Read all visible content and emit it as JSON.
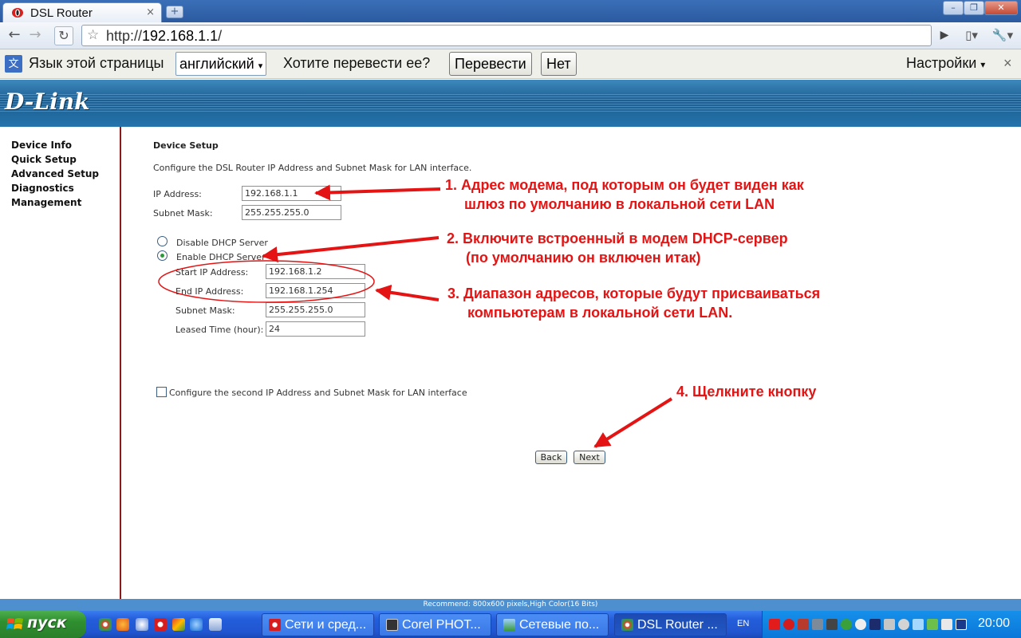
{
  "browser": {
    "tab_title": "DSL Router",
    "tab_close": "×",
    "new_tab": "+",
    "url_prefix": "http://",
    "url_host": "192.168.1.1",
    "url_suffix": "/",
    "icons": [
      "back-icon",
      "forward-icon",
      "reload-icon",
      "star-icon",
      "go-icon",
      "page-menu-icon",
      "wrench-icon"
    ]
  },
  "translate_bar": {
    "language_label": "Язык этой страницы",
    "language_value": "английский",
    "question": "Хотите перевести ее?",
    "translate_button": "Перевести",
    "no_button": "Нет",
    "settings": "Настройки",
    "close": "×"
  },
  "router": {
    "brand": "D-Link",
    "menu": [
      "Device Info",
      "Quick Setup",
      "Advanced Setup",
      "Diagnostics",
      "Management"
    ],
    "section_title": "Device Setup",
    "description": "Configure the DSL Router IP Address and Subnet Mask for LAN interface.",
    "ip_label": "IP Address:",
    "ip_value": "192.168.1.1",
    "mask_label": "Subnet Mask:",
    "mask_value": "255.255.255.0",
    "disable_dhcp": "Disable DHCP Server",
    "enable_dhcp": "Enable DHCP Server",
    "dhcp_enabled": true,
    "start_ip_label": "Start IP Address:",
    "start_ip_value": "192.168.1.2",
    "end_ip_label": "End IP Address:",
    "end_ip_value": "192.168.1.254",
    "dhcp_mask_label": "Subnet Mask:",
    "dhcp_mask_value": "255.255.255.0",
    "lease_label": "Leased Time (hour):",
    "lease_value": "24",
    "second_ip_label": "Configure the second IP Address and Subnet Mask for LAN interface",
    "second_ip_checked": false,
    "back_button": "Back",
    "next_button": "Next",
    "status_text": "Recommend: 800x600 pixels,High Color(16 Bits)"
  },
  "annotations": {
    "a1_line1": "1. Адрес модема, под которым он будет виден как",
    "a1_line2": "шлюз по умолчанию  в локальной сети LAN",
    "a2_line1": "2. Включите встроенный в модем DHCP-сервер",
    "a2_line2": "(по умолчанию он включен итак)",
    "a3_line1": "3. Диапазон адресов, которые будут присваиваться",
    "a3_line2": "компьютерам в локальной сети LAN.",
    "a4": "4. Щелкните кнопку",
    "color": "#e41414"
  },
  "taskbar": {
    "start": "пуск",
    "tasks": [
      "Сети и сред...",
      "Corel PHOT...",
      "Сетевые по...",
      "DSL Router ..."
    ],
    "active_task": 3,
    "lang": "EN",
    "clock": "20:00"
  }
}
